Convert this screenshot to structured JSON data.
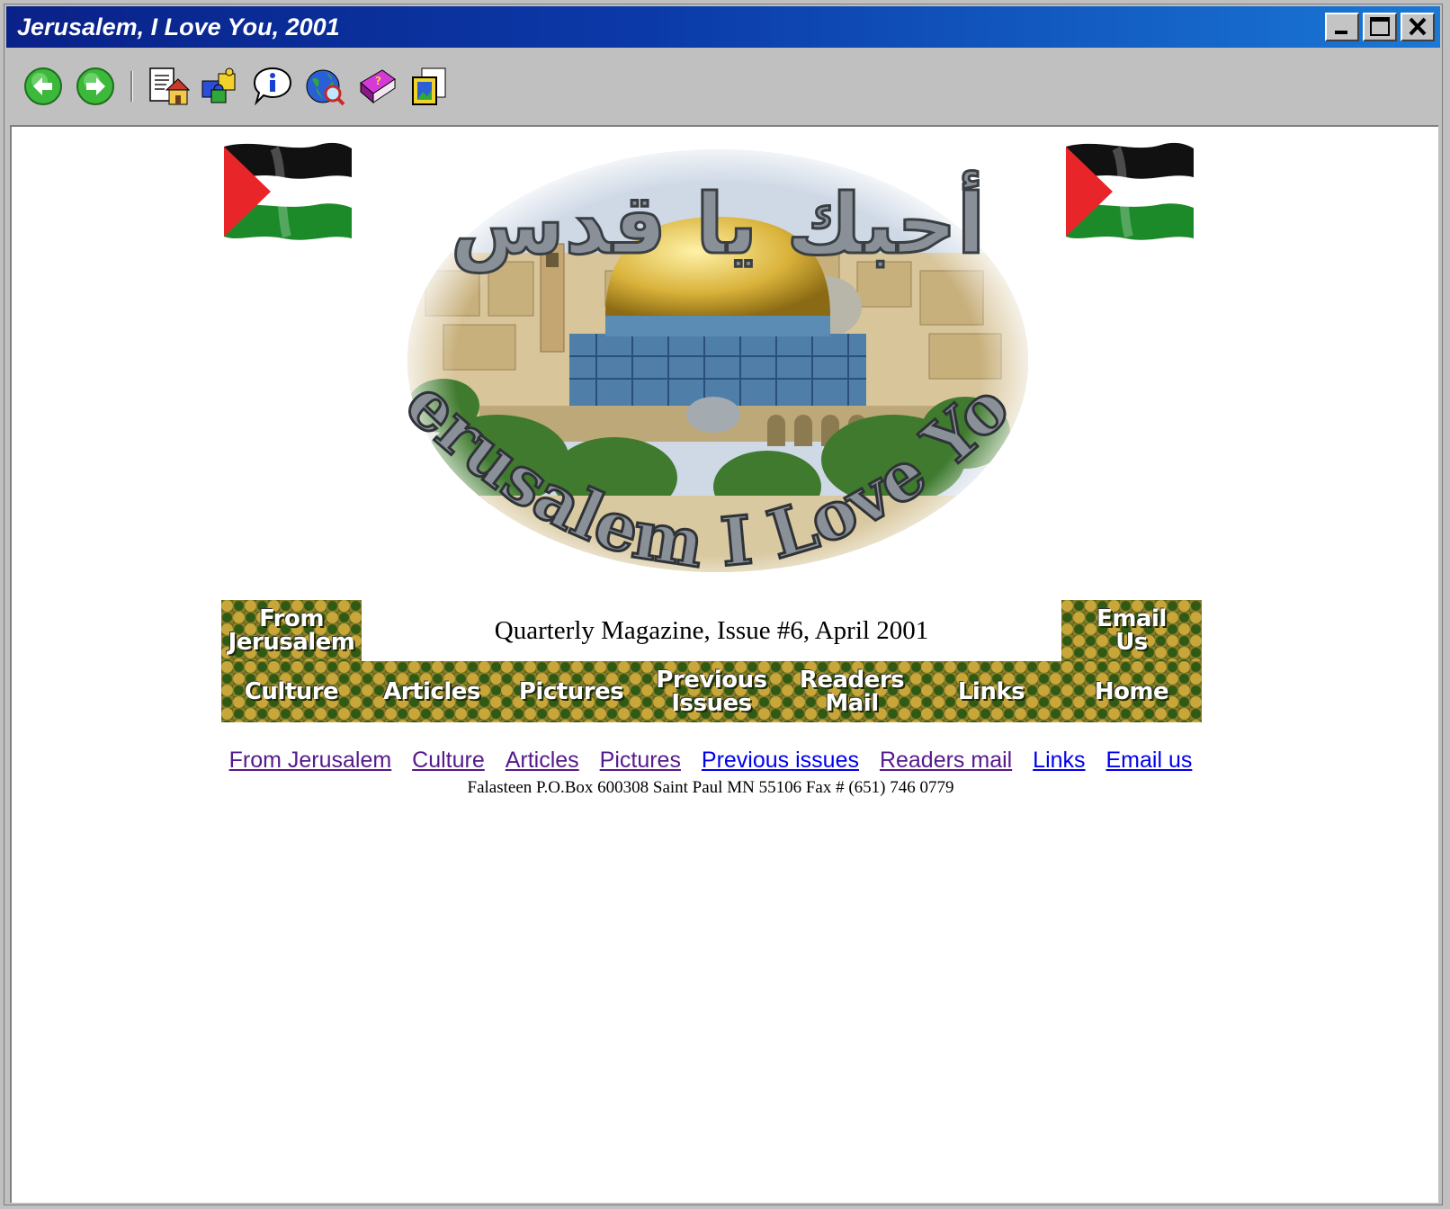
{
  "window": {
    "title": "Jerusalem, I Love You, 2001",
    "controls": [
      "minimize",
      "maximize",
      "close"
    ]
  },
  "toolbar": {
    "buttons": [
      {
        "icon": "back-arrow-icon"
      },
      {
        "icon": "forward-arrow-icon"
      },
      {
        "icon": "home-page-icon"
      },
      {
        "icon": "puzzle-icon"
      },
      {
        "icon": "info-bubble-icon"
      },
      {
        "icon": "globe-search-icon"
      },
      {
        "icon": "help-book-icon"
      },
      {
        "icon": "frame-picture-icon"
      }
    ]
  },
  "banner": {
    "arabic_title": "أحبك يا قدس",
    "english_title": "Jerusalem I Love You"
  },
  "headline": "Quarterly Magazine, Issue #6, April 2001",
  "nav_buttons": {
    "from_jerusalem": [
      "From",
      "Jerusalem"
    ],
    "email_us": [
      "Email",
      "Us"
    ],
    "culture": "Culture",
    "articles": "Articles",
    "pictures": "Pictures",
    "previous_issues": [
      "Previous",
      "Issues"
    ],
    "readers_mail": [
      "Readers",
      "Mail"
    ],
    "links": "Links",
    "home": "Home"
  },
  "text_links": [
    {
      "label": "From Jerusalem",
      "visited": true
    },
    {
      "label": "Culture",
      "visited": true
    },
    {
      "label": "Articles",
      "visited": true
    },
    {
      "label": "Pictures",
      "visited": true
    },
    {
      "label": "Previous issues",
      "visited": false
    },
    {
      "label": "Readers mail",
      "visited": true
    },
    {
      "label": "Links",
      "visited": false
    },
    {
      "label": "Email us",
      "visited": false
    }
  ],
  "address": "Falasteen P.O.Box 600308 Saint Paul MN 55106 Fax # (651) 746 0779",
  "colors": {
    "title_bar_start": "#0a2189",
    "title_bar_end": "#1a78d6",
    "link": "#0000ee",
    "visited_link": "#551a8b",
    "flag_red": "#e8262a",
    "flag_green": "#1d8a2a"
  }
}
